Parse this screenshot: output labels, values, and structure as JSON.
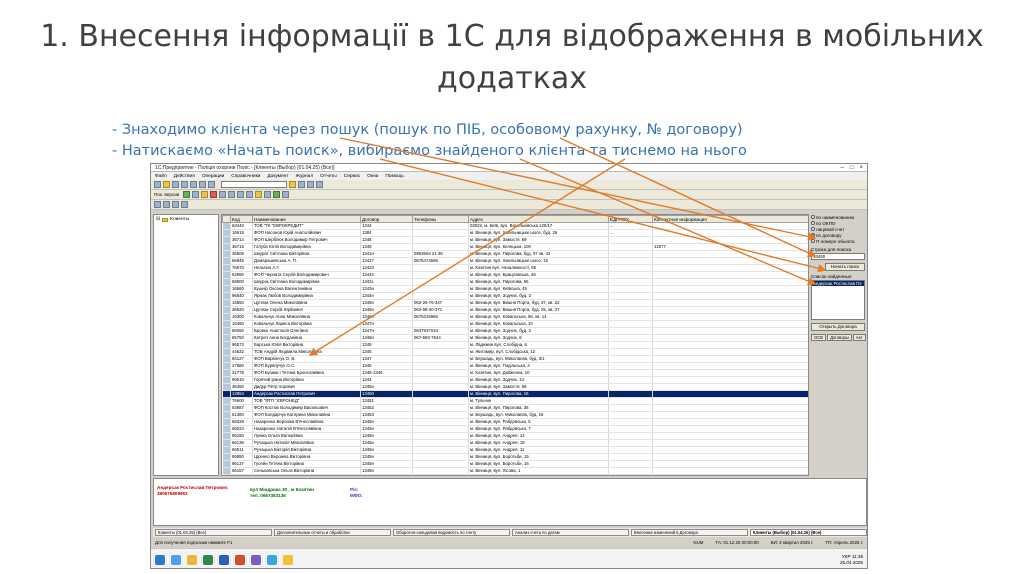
{
  "slide": {
    "title": "1. Внесення інформації в 1С для відображення в мобільних додатках",
    "bullet1": "- Знаходимо клієнта через пошук (пошук по ПІБ, особовому рахунку, № договору)",
    "bullet2": "- Натискаємо «Начать поиск», вибираємо знайденого клієнта та тиснемо на нього"
  },
  "app": {
    "window_title": "1С:Предприятие - Поліція охорони Поліс - [Клиенты (Выбор) (01.04.25) (Все)]",
    "menu": [
      "Файл",
      "Действия",
      "Операции",
      "Справочники",
      "Документ",
      "Журнал",
      "Отчеты",
      "Сервис",
      "Окна",
      "Помощь"
    ],
    "toolbar_label": "Пок. версии",
    "tree_root": "Клиенты",
    "columns": [
      "Код",
      "Наименование",
      "Договор",
      "Телефоны",
      "Адрес",
      "ЕДРПОУ",
      "Контактная информация"
    ],
    "rows": [
      [
        "63440",
        "ТОВ \"ТК \"ЕВРОКРЕДИТ\"",
        "1344",
        "",
        "03022, м. Київ, вул. Васильківська 120/17",
        "...",
        ""
      ],
      [
        "16619",
        "ФОП Насонов Юрій Анатолійович",
        "1384",
        "",
        "м. Вінниця, вул. Хмельницьке шосе, буд. 26",
        "...",
        ""
      ],
      [
        "36714",
        "ФОП Шерблюк Володимир Петрович",
        "1348",
        "",
        "м. Вінниця, вул. Замостя, 59",
        "",
        ""
      ],
      [
        "36715",
        "Голуба Юлія Володимирівна",
        "1349",
        "",
        "м. Вінниця, вул. Келецька, 100",
        "",
        "12077"
      ],
      [
        "36606",
        "Шкурат Світлана Вікторівна",
        "1341н",
        "0963564 21 38",
        "м. Вінниця, вул. Пирогова, буд. 97 кв. 42",
        "",
        ""
      ],
      [
        "66946",
        "Домарашевська А. П.",
        "13427",
        "0675474595",
        "м. Вінниця, вул. Хмельницьке шосе, 16",
        "",
        ""
      ],
      [
        "76670",
        "Нельпин А.Г.",
        "13423",
        "",
        "м. Козятин вул. Незалежності, 65",
        "",
        ""
      ],
      [
        "62860",
        "ФОП Черната Сергій Володимирович",
        "13442",
        "",
        "м. Вінниця, вул. Брацлавська, 46",
        "",
        ""
      ],
      [
        "68500",
        "Шкурак Світлана Володимирівна",
        "1342з",
        "",
        "м. Вінниця, вул. Пирогова, 65",
        "",
        ""
      ],
      [
        "16660",
        "Кушнір Оксана Валентинівна",
        "1343н",
        "",
        "м. Вінниця, вул. Київська, 45",
        "",
        ""
      ],
      [
        "96840",
        "Ярмак Любов Володимирівна",
        "1344н",
        "",
        "м. Вінниця, вул. Зодчих, буд. 3",
        "",
        ""
      ],
      [
        "16550",
        "Цуплак Олена Миколаївна",
        "1345н",
        "063-26-76-347",
        "м. Вінниця, вул. Вишня Порта, буд. 37, кв. 22",
        "",
        ""
      ],
      [
        "36620",
        "Цуплак Сергій Юрійович",
        "1346н",
        "063-98-40-371",
        "м. Вінниця, вул. Вишня Порта, буд. 25, кв. 37",
        "",
        ""
      ],
      [
        "16300",
        "Ковальчук Анна Миколаївна",
        "1346н",
        "0675316966",
        "м. Вінниця, вул. Ковальська, 66, кв. 14",
        "",
        ""
      ],
      [
        "16460",
        "Ковальчук Лариса Вікторівна",
        "1347н",
        "",
        "м. Вінниця, вул. Ковальська, 10",
        "",
        ""
      ],
      [
        "66050",
        "Бровко Анастасія Олегівна",
        "1347н",
        "0637937010",
        "м. Вінниця, вул. Зодчих, буд. 3",
        "",
        ""
      ],
      [
        "65750",
        "Катроп Анна Богданівна",
        "1348н",
        "067-593-7644",
        "м. Вінниця, вул. Зодчих, 8",
        "",
        ""
      ],
      [
        "96573",
        "Барська Юлія Вікторівна",
        "1349",
        "",
        "м. Ладижин вул. Слобідна, 6",
        "",
        ""
      ],
      [
        "44632",
        "ТОВ Андрій Людмила Миколаївна",
        "1345",
        "",
        "м. Житомир, вул. Слобідська, 12",
        "",
        ""
      ],
      [
        "94127",
        "ФОП Варвінчук О. В.",
        "1347",
        "",
        "м. Бершадь, вул. Миколаєва, буд. 3/1",
        "",
        ""
      ],
      [
        "27680",
        "ФОП Бурвлучук О.С.",
        "1348",
        "",
        "м. Вінниця, вул. Подільська, 4",
        "",
        ""
      ],
      [
        "31778",
        "ФОП Бузаки і Тетяна Бронславівна",
        "1348-1346",
        "",
        "м. Козятин, вул. Довженка, 10",
        "",
        ""
      ],
      [
        "96510",
        "Горячий Ірина Вікторівна",
        "1344",
        "",
        "м. Вінниця, вул. Зодчих, 14",
        "",
        ""
      ],
      [
        "36350",
        "Дидур Пётр Ігорович",
        "1345н",
        "",
        "м. Вінниця, вул. Замостя, 58",
        "",
        ""
      ],
      [
        "13854",
        "Андерсак Ростислав Петрович",
        "13450",
        "",
        "м. Вінниця, вул. Пирогова, 15",
        "",
        ""
      ],
      [
        "76600",
        "ТОВ \"ФТП \"ЄВРОНЕД\"",
        "13451",
        "",
        "м. Тульчин",
        "",
        ""
      ],
      [
        "63687",
        "ФОП Костюк Володимир Васильович",
        "13452",
        "",
        "м. Вінниця, вул. Пирогова, 36",
        "",
        ""
      ],
      [
        "61380",
        "ФОП Бондарчук Катерина Миколаївна",
        "13453",
        "",
        "м. Бершадь, вул. Миколаєва, буд. 16",
        "",
        ""
      ],
      [
        "68328",
        "Назаренко Вероніка В'ячеславівна",
        "1345н",
        "",
        "м. Вінниця, вул. Рабдовська, 5",
        "",
        ""
      ],
      [
        "66024",
        "Назаренко Наталія В'ячеславівна",
        "1345н",
        "",
        "м. Вінниця, вул. Рабдовська, 7",
        "",
        ""
      ],
      [
        "96180",
        "Лукіна Ольга Валеріївна",
        "1345н",
        "",
        "м. Вінниця, вул. Андрея, 14",
        "",
        ""
      ],
      [
        "66136",
        "Ручацька Наталія Миколаївна",
        "1345н",
        "",
        "м. Вінниця, вул. Андрея, 18",
        "",
        ""
      ],
      [
        "66511",
        "Ручацька Вікторія Вікторівна",
        "1345н",
        "",
        "м. Вінниця, вул. Андрея, 11",
        "",
        ""
      ],
      [
        "95850",
        "Ціренко Вероніка Вікторівна",
        "1345н",
        "",
        "м. Вінниця, вул. Боротьби, 15",
        "",
        ""
      ],
      [
        "96137",
        "Гусейн Тетяна Вікторівна",
        "1345н",
        "",
        "м. Вінниця, вул. Боротьби, 16",
        "",
        ""
      ],
      [
        "66157",
        "Сеньковська Ольга Вікторівна",
        "1345н",
        "",
        "м. Вінниця, вул. Лісова, 1",
        "",
        ""
      ],
      [
        "26120",
        "Смолюк В. В.",
        "1345н",
        "",
        "м. Вінниця, вул. Лісова, 8",
        "",
        ""
      ],
      [
        "36015",
        "Бояк Світлана Іванівна",
        "1345н",
        "",
        "м. Вінниця, вул. Лісова, 29",
        "",
        ""
      ],
      [
        "38232",
        "Сиволанек Андрій Григорович",
        "1345н",
        "",
        "м. Вінниця, вул. Гоголя, 4",
        "",
        ""
      ],
      [
        "44621",
        "ТОВ Андрій Людмила Миколаївна",
        "1345",
        "",
        "м. Житомир, вул. Слобідська, 12",
        "",
        ""
      ],
      [
        "26120",
        "Ручацька Вікторія Вікторівна",
        "1345н",
        "",
        "м. Вінниця, вул. Андрея, 21",
        "",
        ""
      ],
      [
        "95640",
        "Цибанюк Віктор Вікторович",
        "1345н",
        "",
        "м. Вінниця, вул. Лісова, 27",
        "",
        ""
      ],
      [
        "66012",
        "Цибанюк Тамара Іванівна",
        "1345н",
        "",
        "м. Вінниця, вул. Лісова, 42",
        "",
        ""
      ],
      [
        "76560",
        "ТОВ \"Генеральна\" ОДО №1 \"Світоч\"",
        "1345н",
        "",
        "м. Вінниця, вул. Сабовка, 1",
        "",
        ""
      ],
      [
        "81312",
        "ТОВАРИСТВО З ОБМЕЖЕНОЮ ВІДПОВІДАЛЬНІСТЮ",
        "1345н",
        "",
        "м. Вінниця, вул. Таричак, 2",
        "",
        ""
      ],
      [
        "66683",
        "Кушнір Вероніка Вікторівна",
        "1345н",
        "",
        "м. Вінниця, вул. Сабовка, 8",
        "",
        ""
      ],
      [
        "66654",
        "Кушнір Анастасія Вікторівна",
        "1345н",
        "",
        "м. Вінниця, вул. Сабовка, 9",
        "",
        ""
      ],
      [
        "96033",
        "Кушнір Анастасія Вікторівна",
        "1345н",
        "",
        "м. Вінниця, вул. Сабовка, 11",
        "",
        ""
      ]
    ],
    "search_options": [
      "по наименованию",
      "по ОКПО",
      "лицевой счет",
      "по договору",
      "П номере обьекта"
    ],
    "search_label": "Строка для поиска",
    "search_value": "13450",
    "search_button": "Начать поиск",
    "found_label": "Список найденных:",
    "found_item": "Андерсак Ростислав Пе",
    "open_contract": "Открыть Договора",
    "panel_tabs": [
      "ОСВ",
      "Договоры",
      "Акт"
    ],
    "client_name": "Андерсак Ростислав Петрович",
    "client_phone": "380676809962",
    "client_address": "вул Міндрика 30 , м Козятин",
    "client_tel": "тел. 0667353136",
    "client_ps": "Р/с:",
    "client_mfo": "МФО:",
    "taskbar_items": [
      "Клиенты (01.04.25) (Все)",
      "Дополнительные отчеты и обработки",
      "Оборотно-сальдовая ведомость по счету",
      "Анализ счета по датам",
      "Внесение изменений в Договора",
      "Клиенты (Выбор) (01.04.25) (Все)"
    ],
    "status_left": "Для получения подсказки нажмите F1",
    "status_right": [
      "NUM",
      "ТА: 01.12.25 00:00:00",
      "БИ: 2 квартал 2025 г.",
      "ТП: Апрель 2025 г."
    ],
    "clock_time": "11:38",
    "clock_date": "25.04.2025",
    "lang": "УКР"
  }
}
